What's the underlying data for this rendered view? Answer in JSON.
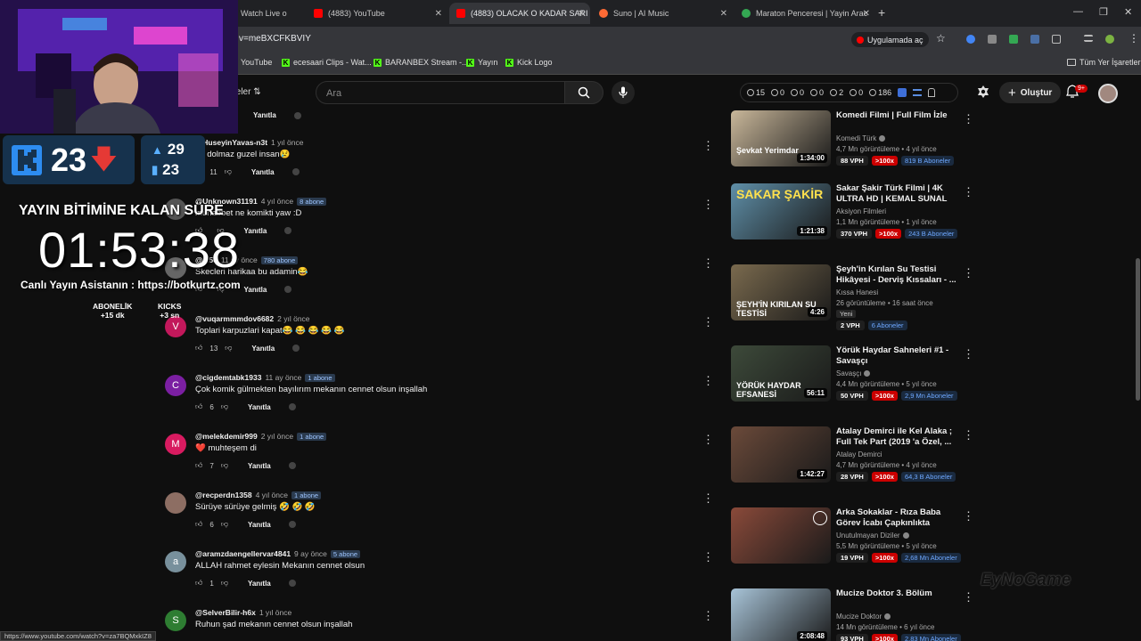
{
  "browser": {
    "tabs": [
      {
        "label": "Watch Live o"
      },
      {
        "label": "(4883) YouTube"
      },
      {
        "label": "(4883) OLACAK O KADAR SARI"
      },
      {
        "label": "Suno | AI Music"
      },
      {
        "label": "Maraton Penceresi | Yayin Arac"
      }
    ],
    "url": "v=meBXCFKBVIY",
    "open_app": "Uygulamada aç",
    "bookmarks": [
      "YouTube",
      "ecesaari Clips - Wat...",
      "BARANBEX Stream -...",
      "Yayın",
      "Kick Logo"
    ],
    "all_bookmarks": "Tüm Yer İşaretleri",
    "status_url": "https://www.youtube.com/watch?v=za7BQMxkIZ8"
  },
  "youtube": {
    "filters_label": "ıeler",
    "search_placeholder": "Ara",
    "stats": [
      "15",
      "0",
      "0",
      "0",
      "2",
      "0",
      "186"
    ],
    "create_label": "Oluştur",
    "notif_count": "9+"
  },
  "comments": [
    {
      "user": "",
      "ago": "",
      "badge": "",
      "text": "",
      "likes": "",
      "reply": "Yanıtla",
      "avatar_letter": "",
      "avatar_color": "#0f0f0f"
    },
    {
      "user": "@HuseyinYavas-n3t",
      "ago": "1 yıl önce",
      "badge": "",
      "text": "rin dolmaz guzel insan😢",
      "likes": "11",
      "reply": "Yanıtla",
      "avatar_letter": "",
      "avatar_color": "#555"
    },
    {
      "user": "@Unknown31191",
      "ago": "4 yıl önce",
      "badge": "8 abone",
      "text": "muhabbet ne komikti yaw :D",
      "likes": "",
      "reply": "Yanıtla",
      "avatar_letter": "",
      "avatar_color": "#555"
    },
    {
      "user": "@...50",
      "ago": "11 ay önce",
      "badge": "780 abone",
      "text": "Skecleri harikaa bu adamin😂",
      "likes": "",
      "reply": "Yanıtla",
      "avatar_letter": "",
      "avatar_color": "#666"
    },
    {
      "user": "@vuqarmmmdov6682",
      "ago": "2 yıl önce",
      "badge": "",
      "text": "Toplari karpuzlari kapat😂 😂 😂 😂 😂",
      "likes": "13",
      "reply": "Yanıtla",
      "avatar_letter": "V",
      "avatar_color": "#c2185b"
    },
    {
      "user": "@cigdemtabk1933",
      "ago": "11 ay önce",
      "badge": "1 abone",
      "text": "Çok  komik gülmekten bayılırım mekanın cennet olsun  inşallah",
      "likes": "6",
      "reply": "Yanıtla",
      "avatar_letter": "C",
      "avatar_color": "#7b1fa2"
    },
    {
      "user": "@melekdemir999",
      "ago": "2 yıl önce",
      "badge": "1 abone",
      "text": "❤️ muhteşem di",
      "likes": "7",
      "reply": "Yanıtla",
      "avatar_letter": "M",
      "avatar_color": "#d81b60"
    },
    {
      "user": "@recperdn1358",
      "ago": "4 yıl önce",
      "badge": "1 abone",
      "text": "Sürüye sürüye gelmiş 🤣 🤣 🤣",
      "likes": "6",
      "reply": "Yanıtla",
      "avatar_letter": "",
      "avatar_color": "#8d6e63"
    },
    {
      "user": "@aramzdaengellervar4841",
      "ago": "9 ay önce",
      "badge": "5 abone",
      "text": "ALLAH rahmet eylesin  Mekanın cennet olsun",
      "likes": "1",
      "reply": "Yanıtla",
      "avatar_letter": "a",
      "avatar_color": "#78909c"
    },
    {
      "user": "@SelverBilir-h6x",
      "ago": "1 yıl önce",
      "badge": "",
      "text": "Ruhun şad mekanın cennet olsun inşallah",
      "likes": "",
      "reply": "",
      "avatar_letter": "S",
      "avatar_color": "#2e7d32"
    }
  ],
  "recommendations": [
    {
      "title": "Komedi Filmi | Full Film İzle",
      "channel": "Komedi Türk",
      "verified": true,
      "meta": "4,7 Mn görüntüleme • 4 yıl önce",
      "vph": "88 VPH",
      "x": ">100x",
      "subs": "819 B Aboneler",
      "duration": "1:34:00",
      "thumb_text": "Şevkat Yerimdar",
      "thumb_bg": "#c9b79a",
      "new": false
    },
    {
      "title": "Sakar Şakir Türk Filmi | 4K ULTRA HD | KEMAL SUNAL",
      "channel": "Aksiyon Filmleri",
      "verified": false,
      "meta": "1,1 Mn görüntüleme • 1 yıl önce",
      "vph": "370 VPH",
      "x": ">100x",
      "subs": "243 B Aboneler",
      "duration": "1:21:38",
      "thumb_text": "SAKAR ŞAKİR",
      "thumb_bg": "#5f8fa8",
      "new": false
    },
    {
      "title": "Şeyh'in Kırılan Su Testisi Hikâyesi - Derviş Kıssaları - ...",
      "channel": "Kıssa Hanesi",
      "verified": false,
      "meta": "26 görüntüleme • 16 saat önce",
      "vph": "2 VPH",
      "x": "",
      "subs": "6 Aboneler",
      "duration": "4:26",
      "thumb_text": "ŞEYH'İN KIRILAN SU TESTİSİ",
      "thumb_bg": "#7a6a4e",
      "new": true,
      "new_label": "Yeni"
    },
    {
      "title": "Yörük Haydar Sahneleri #1 - Savaşçı",
      "channel": "Savaşçı",
      "verified": true,
      "meta": "4,4 Mn görüntüleme • 5 yıl önce",
      "vph": "50 VPH",
      "x": ">100x",
      "subs": "2,9 Mn Aboneler",
      "duration": "56:11",
      "thumb_text": "YÖRÜK HAYDAR EFSANESİ",
      "thumb_bg": "#3d4a3a",
      "new": false
    },
    {
      "title": "Atalay Demirci ile Kel Alaka ; Full Tek Part (2019 'a Özel, ...",
      "channel": "Atalay Demirci",
      "verified": false,
      "meta": "4,7 Mn görüntüleme • 4 yıl önce",
      "vph": "28 VPH",
      "x": ">100x",
      "subs": "64,3 B Aboneler",
      "duration": "1:42:27",
      "thumb_text": "",
      "thumb_bg": "#6b4a3a",
      "new": false
    },
    {
      "title": "Arka Sokaklar - Rıza Baba Görev İcabı Çapkınlıkta",
      "channel": "Unutulmayan Diziler",
      "verified": true,
      "meta": "5,5 Mn görüntüleme • 5 yıl önce",
      "vph": "19 VPH",
      "x": ">100x",
      "subs": "2,68 Mn Aboneler",
      "duration": "",
      "thumb_text": "",
      "thumb_bg": "#8a4a3a",
      "new": false
    },
    {
      "title": "Mucize Doktor 3. Bölüm",
      "channel": "Mucize Doktor",
      "verified": true,
      "meta": "14 Mn görüntüleme • 6 yıl önce",
      "vph": "93 VPH",
      "x": ">100x",
      "subs": "2,83 Mn Aboneler",
      "duration": "2:08:48",
      "thumb_text": "",
      "thumb_bg": "#a8c4d8",
      "new": false
    }
  ],
  "overlay": {
    "kick_count": "23",
    "stat_top": "29",
    "stat_bottom": "23",
    "timer_title": "YAYIN BİTİMİNE KALAN SÜRE",
    "timer": "01:53:38",
    "assistant": "Canlı Yayın Asistanın : https://botkurtz.com",
    "abonelik_label": "ABONELİK",
    "abonelik_value": "+15 dk",
    "kicks_label": "KICKS",
    "kicks_value": "+3 sn",
    "watermark": "EyNoGame"
  }
}
